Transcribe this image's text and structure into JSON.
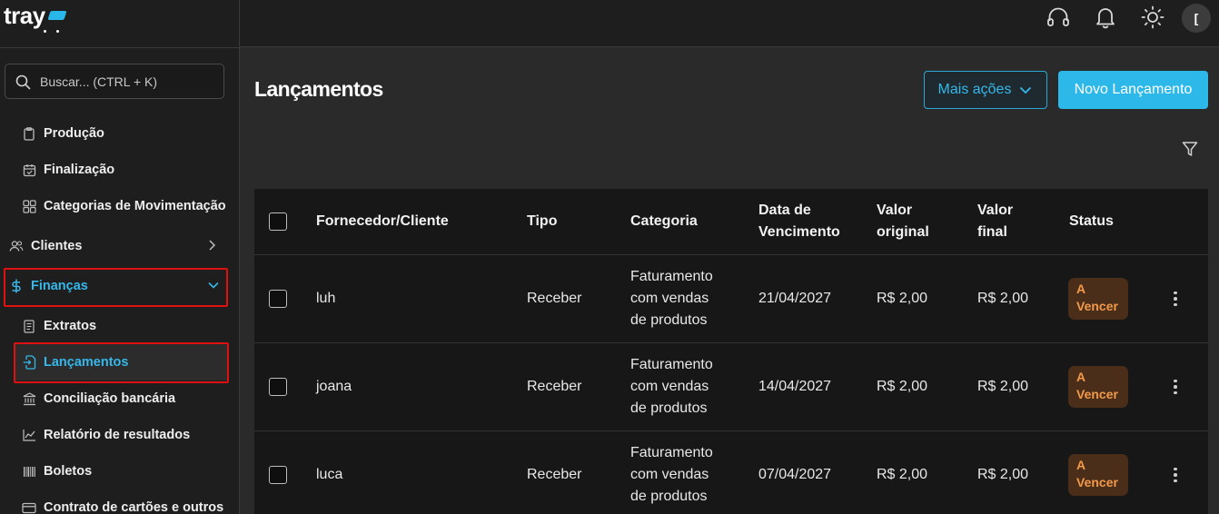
{
  "brand": {
    "name": "tray"
  },
  "search": {
    "placeholder": "Buscar... (CTRL + K)"
  },
  "sidebar": {
    "items": [
      {
        "label": "Produção"
      },
      {
        "label": "Finalização"
      },
      {
        "label": "Categorias de Movimentação"
      },
      {
        "label": "Clientes"
      },
      {
        "label": "Finanças"
      },
      {
        "label": "Extratos"
      },
      {
        "label": "Lançamentos"
      },
      {
        "label": "Conciliação bancária"
      },
      {
        "label": "Relatório de resultados"
      },
      {
        "label": "Boletos"
      },
      {
        "label": "Contrato de cartões e outros"
      }
    ]
  },
  "header": {
    "avatar_initial": "["
  },
  "page": {
    "title": "Lançamentos",
    "more_actions_label": "Mais ações",
    "new_entry_label": "Novo Lançamento"
  },
  "table": {
    "columns": {
      "fornecedor": "Fornecedor/Cliente",
      "tipo": "Tipo",
      "categoria": "Categoria",
      "vencimento_1": "Data de",
      "vencimento_2": "Vencimento",
      "original_1": "Valor",
      "original_2": "original",
      "final_1": "Valor",
      "final_2": "final",
      "status": "Status"
    },
    "rows": [
      {
        "fornecedor": "luh",
        "tipo": "Receber",
        "categoria_1": "Faturamento",
        "categoria_2": "com vendas",
        "categoria_3": "de produtos",
        "vencimento": "21/04/2027",
        "original": "R$ 2,00",
        "final": "R$ 2,00",
        "status_1": "A",
        "status_2": "Vencer"
      },
      {
        "fornecedor": "joana",
        "tipo": "Receber",
        "categoria_1": "Faturamento",
        "categoria_2": "com vendas",
        "categoria_3": "de produtos",
        "vencimento": "14/04/2027",
        "original": "R$ 2,00",
        "final": "R$ 2,00",
        "status_1": "A",
        "status_2": "Vencer"
      },
      {
        "fornecedor": "luca",
        "tipo": "Receber",
        "categoria_1": "Faturamento",
        "categoria_2": "com vendas",
        "categoria_3": "de produtos",
        "vencimento": "07/04/2027",
        "original": "R$ 2,00",
        "final": "R$ 2,00",
        "status_1": "A",
        "status_2": "Vencer"
      }
    ]
  },
  "colors": {
    "accent": "#2db8ea",
    "highlight_border": "#e01010",
    "status_bg": "#4a2e1a",
    "status_text": "#f29a4a"
  }
}
